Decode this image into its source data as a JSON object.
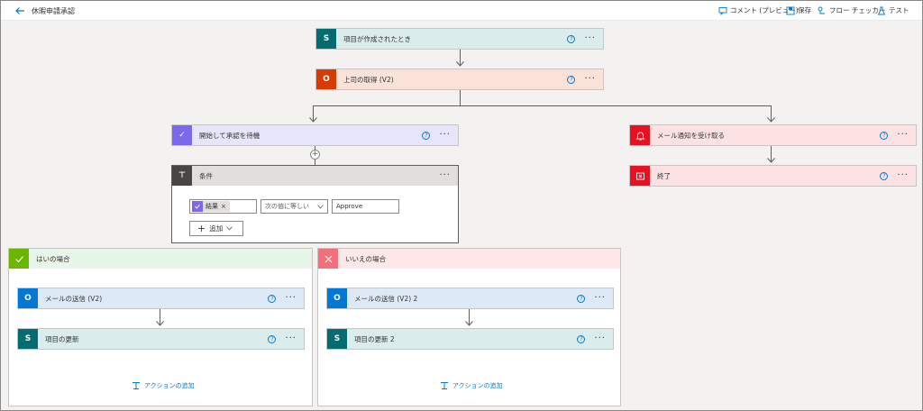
{
  "topbar": {
    "title": "休暇申請承認",
    "tools": [
      {
        "label": "コメント (プレビュー)",
        "icon": "comment-icon"
      },
      {
        "label": "保存",
        "icon": "save-icon"
      },
      {
        "label": "フロー チェッカー",
        "icon": "flow-checker-icon"
      },
      {
        "label": "テスト",
        "icon": "test-icon"
      }
    ]
  },
  "steps": {
    "trigger": {
      "label": "項目が作成されたとき",
      "icon": "sharepoint-icon",
      "color": "#036c70"
    },
    "manager": {
      "label": "上司の取得 (V2)",
      "icon": "office-icon",
      "color": "#d83b01"
    },
    "approval": {
      "label": "開始して承認を待機",
      "icon": "approvals-icon",
      "color": "#7b68ee"
    },
    "notify": {
      "label": "メール通知を受け取る",
      "icon": "bell-icon",
      "color": "#e81123"
    },
    "terminate": {
      "label": "終了",
      "icon": "terminate-icon",
      "color": "#e81123"
    },
    "condition": {
      "label": "条件",
      "icon": "condition-icon",
      "color": "#484644"
    }
  },
  "condition": {
    "token": "結果",
    "operator": "次の値に等しい",
    "value": "Approve",
    "add_label": "追加"
  },
  "branches": {
    "yes": {
      "label": "はいの場合",
      "color": "#e8f5e9",
      "steps": [
        {
          "label": "メールの送信 (V2)",
          "icon": "outlook-icon"
        },
        {
          "label": "項目の更新",
          "icon": "sharepoint-icon"
        }
      ],
      "add_action": "アクションの追加"
    },
    "no": {
      "label": "いいえの場合",
      "color": "#fde7e9",
      "steps": [
        {
          "label": "メールの送信 (V2) 2",
          "icon": "outlook-icon"
        },
        {
          "label": "項目の更新 2",
          "icon": "sharepoint-icon"
        }
      ],
      "add_action": "アクションの追加"
    }
  },
  "help_glyph": "?",
  "more_glyph": "···"
}
